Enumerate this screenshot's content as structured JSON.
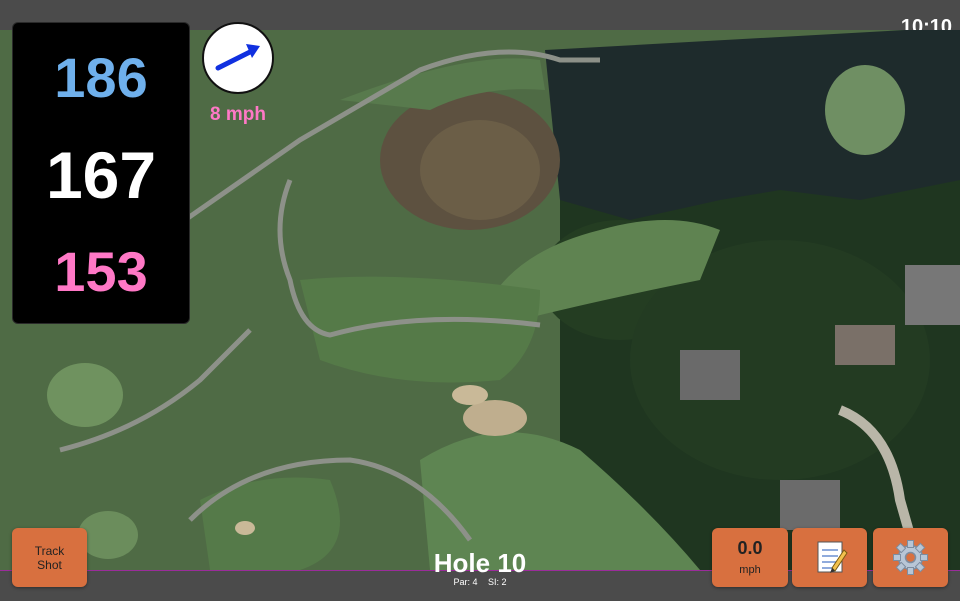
{
  "status": {
    "time": "10:10"
  },
  "distances": {
    "back": "186",
    "middle": "167",
    "front": "153"
  },
  "wind": {
    "label": "8 mph",
    "direction_icon": "arrow-icon"
  },
  "buttons": {
    "track_shot": [
      "Track",
      "Shot"
    ],
    "wind_speed_value": "0.0",
    "wind_speed_unit": "mph",
    "notes_icon": "notepad-icon",
    "settings_icon": "gear-icon"
  },
  "hole": {
    "title": "Hole 10",
    "par": "Par: 4",
    "si": "SI: 2"
  },
  "colors": {
    "back": "#6fb0ec",
    "middle": "#ffffff",
    "front": "#ff78c6",
    "button": "#d8703f",
    "accent_border": "#9b2c9b"
  }
}
